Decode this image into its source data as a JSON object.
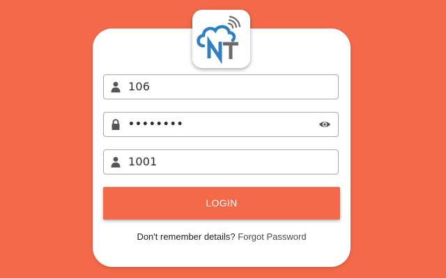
{
  "colors": {
    "background": "#f4694a",
    "accent": "#f4694a",
    "logo_blue": "#2f7fc1",
    "logo_gray": "#6b6b6b"
  },
  "logo": {
    "text": "NT"
  },
  "form": {
    "username": {
      "value": "106",
      "icon": "user-icon"
    },
    "password": {
      "value": "••••••••",
      "icon": "lock-icon",
      "toggle_icon": "eye-icon"
    },
    "code": {
      "value": "1001",
      "icon": "user-icon"
    }
  },
  "login_label": "LOGIN",
  "footer": {
    "question": "Don't remember details?",
    "link": "Forgot Password"
  }
}
